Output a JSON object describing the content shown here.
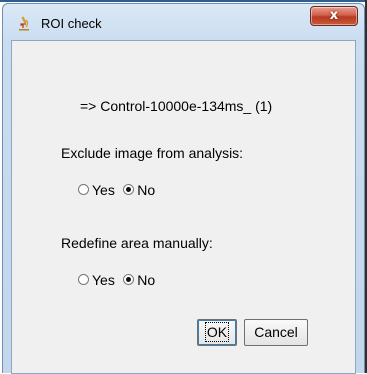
{
  "window": {
    "title": "ROI check",
    "close_label": "x"
  },
  "content": {
    "filename": "=> Control-10000e-134ms_ (1)",
    "exclude_question": "Exclude image from analysis:",
    "exclude_options": {
      "yes": "Yes",
      "no": "No",
      "selected": "No"
    },
    "redefine_question": "Redefine area manually:",
    "redefine_options": {
      "yes": "Yes",
      "no": "No",
      "selected": "No"
    }
  },
  "buttons": {
    "ok": "OK",
    "cancel": "Cancel"
  },
  "icons": {
    "app": "microscope-icon",
    "close": "close-icon"
  },
  "colors": {
    "close_button": "#c85a3c",
    "frame": "#c9dcf0",
    "client": "#f0f0f0"
  }
}
